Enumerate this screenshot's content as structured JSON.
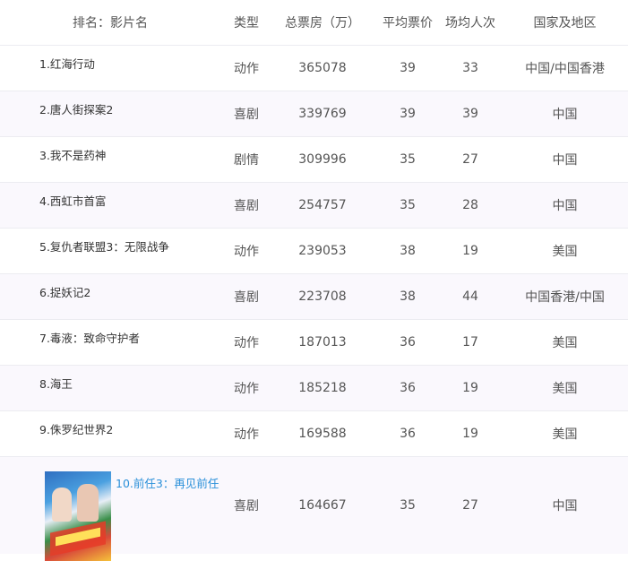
{
  "header": {
    "rank_name": "排名：影片名",
    "type": "类型",
    "box_office": "总票房（万）",
    "avg_price": "平均票价",
    "avg_audience": "场均人次",
    "country": "国家及地区"
  },
  "rows": [
    {
      "name": "1.红海行动",
      "type": "动作",
      "box_office": "365078",
      "avg_price": "39",
      "avg_audience": "33",
      "country": "中国/中国香港"
    },
    {
      "name": "2.唐人街探案2",
      "type": "喜剧",
      "box_office": "339769",
      "avg_price": "39",
      "avg_audience": "39",
      "country": "中国"
    },
    {
      "name": "3.我不是药神",
      "type": "剧情",
      "box_office": "309996",
      "avg_price": "35",
      "avg_audience": "27",
      "country": "中国"
    },
    {
      "name": "4.西虹市首富",
      "type": "喜剧",
      "box_office": "254757",
      "avg_price": "35",
      "avg_audience": "28",
      "country": "中国"
    },
    {
      "name": "5.复仇者联盟3：无限战争",
      "type": "动作",
      "box_office": "239053",
      "avg_price": "38",
      "avg_audience": "19",
      "country": "美国"
    },
    {
      "name": "6.捉妖记2",
      "type": "喜剧",
      "box_office": "223708",
      "avg_price": "38",
      "avg_audience": "44",
      "country": "中国香港/中国"
    },
    {
      "name": "7.毒液：致命守护者",
      "type": "动作",
      "box_office": "187013",
      "avg_price": "36",
      "avg_audience": "17",
      "country": "美国"
    },
    {
      "name": "8.海王",
      "type": "动作",
      "box_office": "185218",
      "avg_price": "36",
      "avg_audience": "19",
      "country": "美国"
    },
    {
      "name": "9.侏罗纪世界2",
      "type": "动作",
      "box_office": "169588",
      "avg_price": "36",
      "avg_audience": "19",
      "country": "美国"
    },
    {
      "name": "10.前任3：再见前任",
      "type": "喜剧",
      "box_office": "164667",
      "avg_price": "35",
      "avg_audience": "27",
      "country": "中国"
    }
  ],
  "colors": {
    "link": "#2b90d9",
    "stripe": "#faf8fd"
  }
}
